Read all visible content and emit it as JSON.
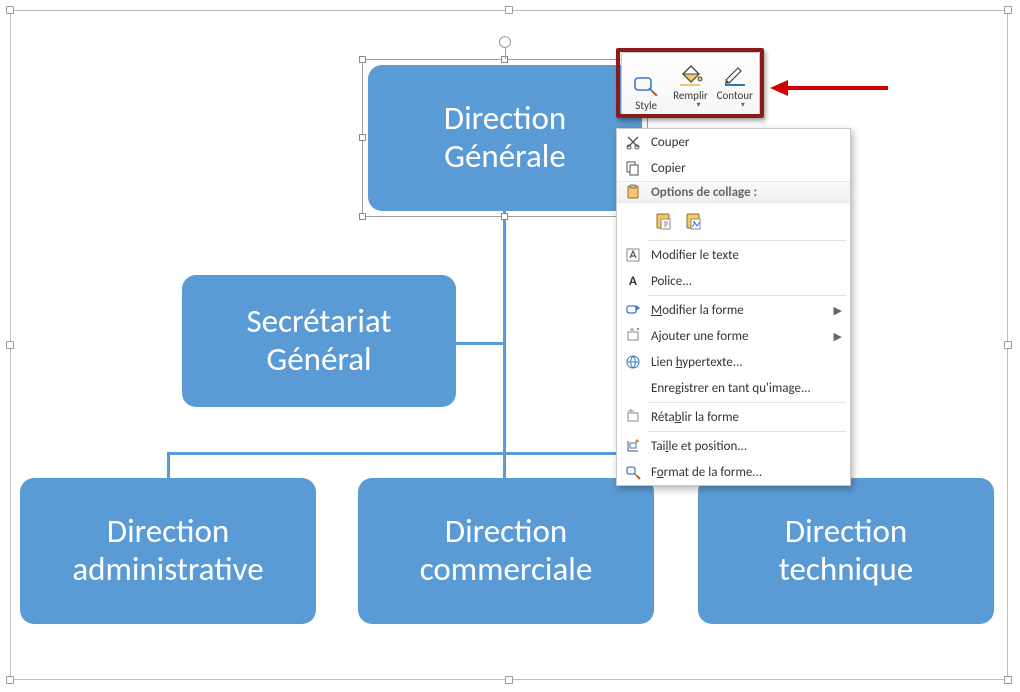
{
  "org": {
    "root": "Direction\nGénérale",
    "secretariat": "Secrétariat\nGénéral",
    "children": [
      "Direction\nadministrative",
      "Direction\ncommerciale",
      "Direction\ntechnique"
    ]
  },
  "mini_toolbar": {
    "style": "Style",
    "fill": "Remplir",
    "outline": "Contour"
  },
  "context_menu": {
    "cut": "Couper",
    "copy": "Copier",
    "paste_options_header": "Options de collage :",
    "edit_text": "Modifier le texte",
    "font": "Police...",
    "change_shape": "Modifier la forme",
    "add_shape": "Ajouter une forme",
    "hyperlink": "Lien hypertexte...",
    "save_as_picture": "Enregistrer en tant qu'image...",
    "reset_shape": "Rétablir la forme",
    "size_position": "Taille et position...",
    "format_shape": "Format de la forme..."
  }
}
